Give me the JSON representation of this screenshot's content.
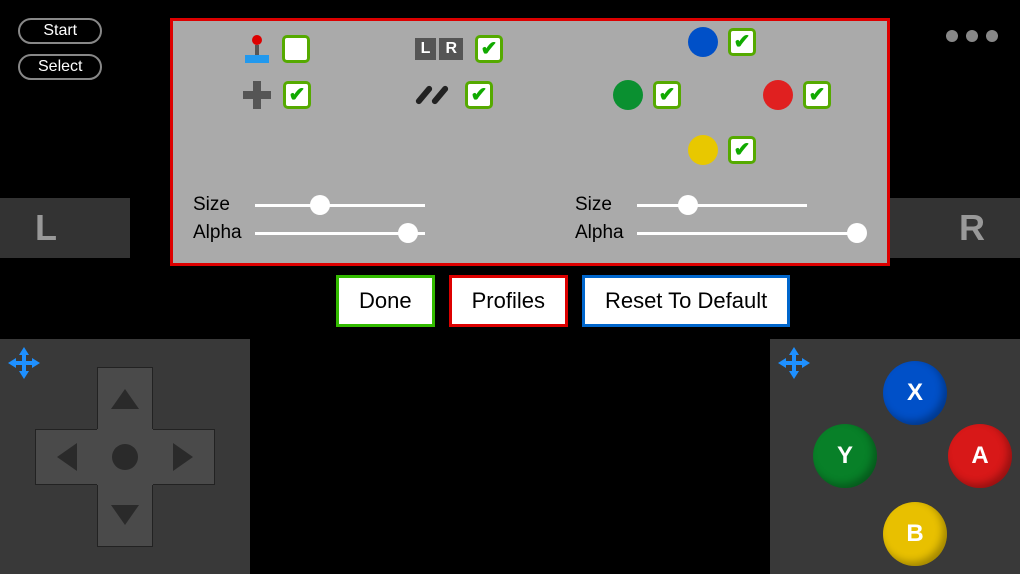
{
  "sys": {
    "start": "Start",
    "select": "Select"
  },
  "shoulders": {
    "L": "L",
    "R": "R"
  },
  "config": {
    "lr_label_L": "L",
    "lr_label_R": "R",
    "left_size_label": "Size",
    "left_alpha_label": "Alpha",
    "right_size_label": "Size",
    "right_alpha_label": "Alpha",
    "left_size_value": 38,
    "left_alpha_value": 90,
    "right_size_value": 30,
    "right_alpha_value": 100,
    "toggles": {
      "joystick": false,
      "dpad": true,
      "lr": true,
      "diag": true,
      "blue": true,
      "green": true,
      "red": true,
      "yellow": true
    }
  },
  "actions": {
    "done": "Done",
    "profiles": "Profiles",
    "reset": "Reset To Default"
  },
  "face_buttons": {
    "x": "X",
    "y": "Y",
    "a": "A",
    "b": "B"
  },
  "colors": {
    "blue": "#0050c8",
    "green": "#088028",
    "red": "#d81818",
    "yellow": "#e8c000",
    "accent_green": "#33bb00",
    "accent_red": "#dd0000",
    "accent_blue": "#0066cc"
  }
}
